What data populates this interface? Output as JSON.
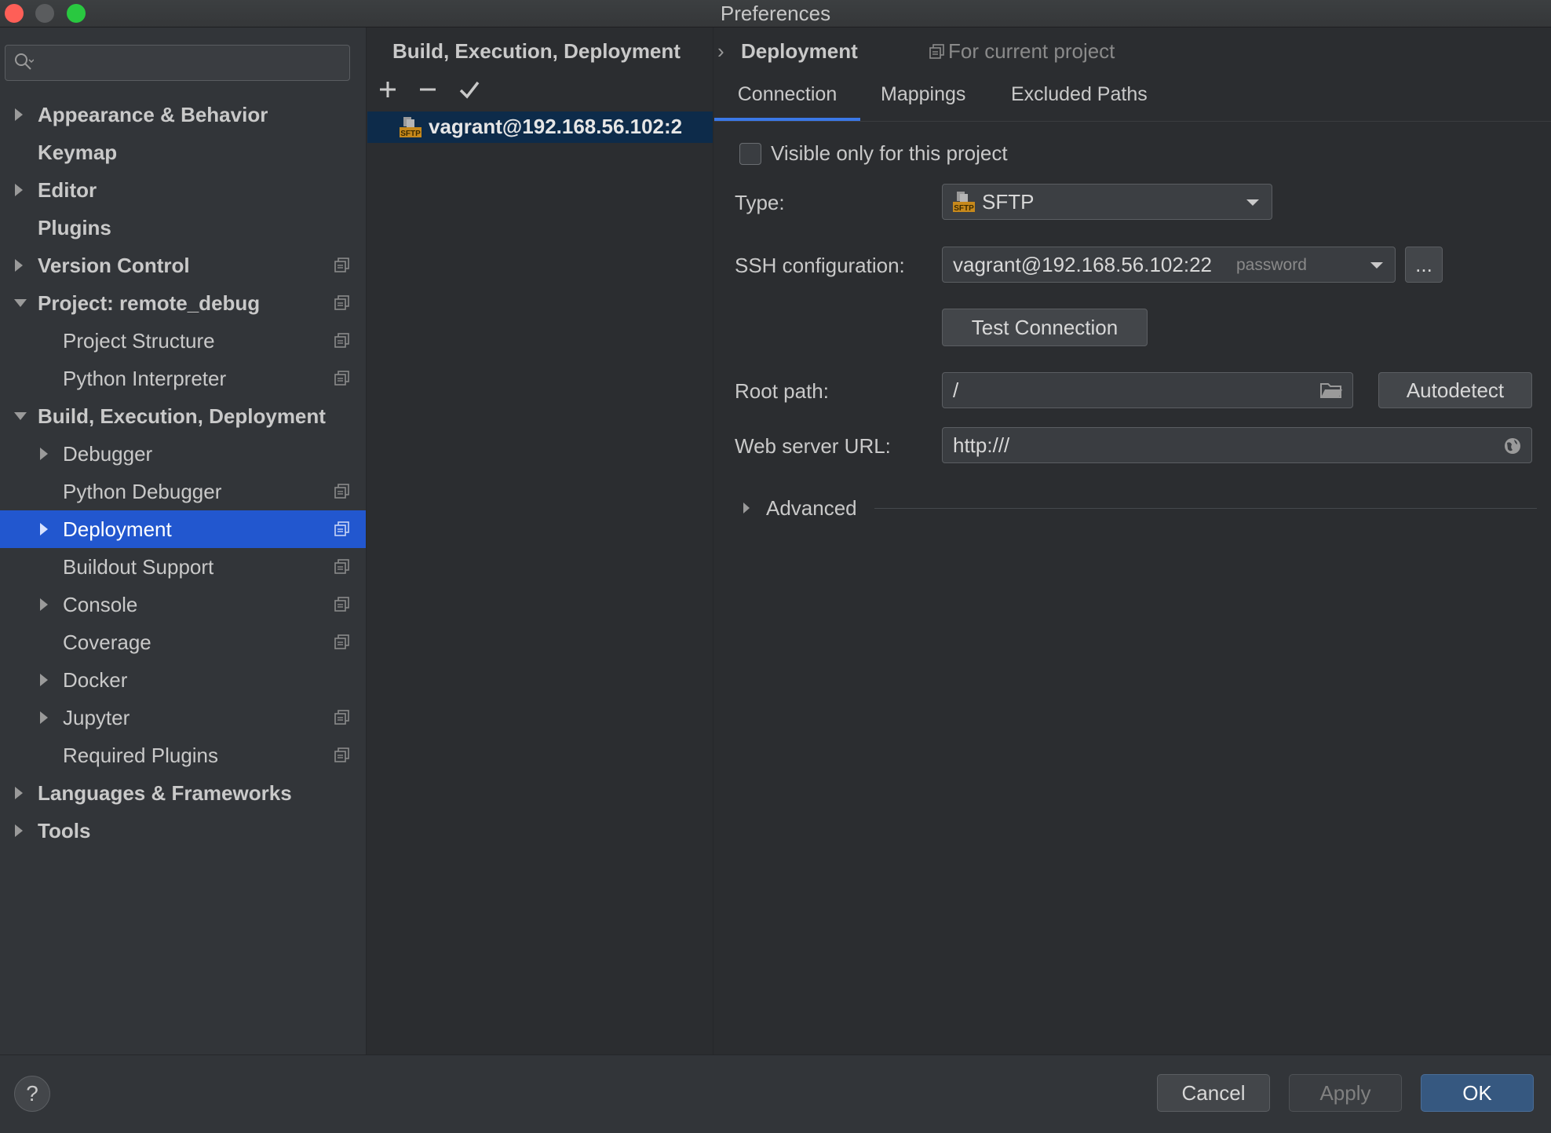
{
  "window": {
    "title": "Preferences"
  },
  "search": {
    "placeholder": ""
  },
  "sidebar": {
    "items": [
      {
        "label": "Appearance & Behavior"
      },
      {
        "label": "Keymap"
      },
      {
        "label": "Editor"
      },
      {
        "label": "Plugins"
      },
      {
        "label": "Version Control"
      },
      {
        "label": "Project: remote_debug"
      },
      {
        "label": "Project Structure"
      },
      {
        "label": "Python Interpreter"
      },
      {
        "label": "Build, Execution, Deployment"
      },
      {
        "label": "Debugger"
      },
      {
        "label": "Python Debugger"
      },
      {
        "label": "Deployment"
      },
      {
        "label": "Buildout Support"
      },
      {
        "label": "Console"
      },
      {
        "label": "Coverage"
      },
      {
        "label": "Docker"
      },
      {
        "label": "Jupyter"
      },
      {
        "label": "Required Plugins"
      },
      {
        "label": "Languages & Frameworks"
      },
      {
        "label": "Tools"
      }
    ]
  },
  "breadcrumb": {
    "parent": "Build, Execution, Deployment",
    "separator": "›",
    "current": "Deployment",
    "scope": "For current project"
  },
  "servers": {
    "items": [
      {
        "label": "vagrant@192.168.56.102:2",
        "badge": "SFTP"
      }
    ]
  },
  "tabs": [
    {
      "label": "Connection"
    },
    {
      "label": "Mappings"
    },
    {
      "label": "Excluded Paths"
    }
  ],
  "connection": {
    "visible_only_label": "Visible only for this project",
    "type_label": "Type:",
    "type_value": "SFTP",
    "ssh_label": "SSH configuration:",
    "ssh_value": "vagrant@192.168.56.102:22",
    "ssh_auth": "password",
    "ssh_more": "...",
    "test_connection": "Test Connection",
    "root_path_label": "Root path:",
    "root_path_value": "/",
    "autodetect": "Autodetect",
    "web_url_label": "Web server URL:",
    "web_url_value": "http:///",
    "advanced_label": "Advanced"
  },
  "footer": {
    "help": "?",
    "cancel": "Cancel",
    "apply": "Apply",
    "ok": "OK"
  },
  "colors": {
    "accent": "#2257cf",
    "ok_button": "#365880",
    "tab_underline": "#3b78e7"
  }
}
